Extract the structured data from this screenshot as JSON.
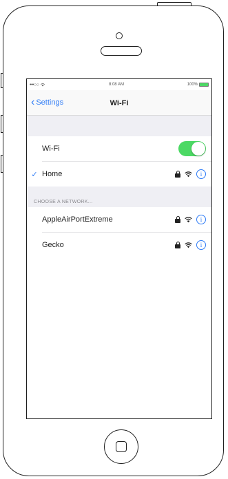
{
  "status_bar": {
    "carrier": "•••○○",
    "time": "8:08 AM",
    "battery": "100%",
    "battery_level": 1.0
  },
  "nav": {
    "back_label": "Settings",
    "title": "Wi-Fi"
  },
  "wifi_toggle": {
    "label": "Wi-Fi",
    "on": true
  },
  "connected_network": {
    "name": "Home",
    "secured": true
  },
  "section_header": "CHOOSE A NETWORK...",
  "networks": [
    {
      "name": "AppleAirPortExtreme",
      "secured": true
    },
    {
      "name": "Gecko",
      "secured": true
    }
  ],
  "icons": {
    "back": "chevron-left-icon",
    "check": "checkmark-icon",
    "lock": "lock-icon",
    "wifi": "wifi-icon",
    "info": "info-icon"
  },
  "colors": {
    "accent": "#2f7cf6",
    "toggle_on": "#4cd964",
    "grouped_bg": "#efeff4"
  }
}
